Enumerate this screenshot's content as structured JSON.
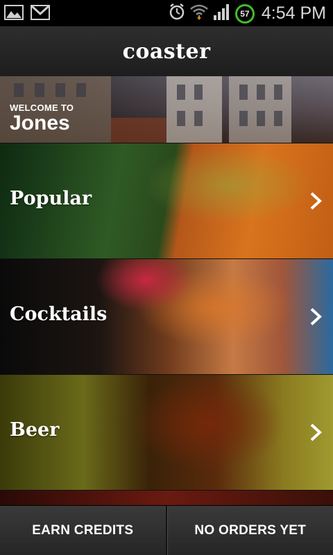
{
  "status_bar": {
    "time": "4:54 PM",
    "battery_level": "57",
    "icons": [
      "gallery-icon",
      "gmail-icon",
      "alarm-icon",
      "wifi-icon",
      "signal-icon"
    ]
  },
  "header": {
    "title": "coaster"
  },
  "venue": {
    "welcome": "WELCOME TO",
    "name": "Jones"
  },
  "categories": [
    {
      "label": "Popular"
    },
    {
      "label": "Cocktails"
    },
    {
      "label": "Beer"
    }
  ],
  "bottom_bar": {
    "earn_credits": "EARN CREDITS",
    "no_orders": "NO ORDERS YET"
  },
  "colors": {
    "battery_ring": "#3fbf2a",
    "header_bg": "#262626"
  }
}
